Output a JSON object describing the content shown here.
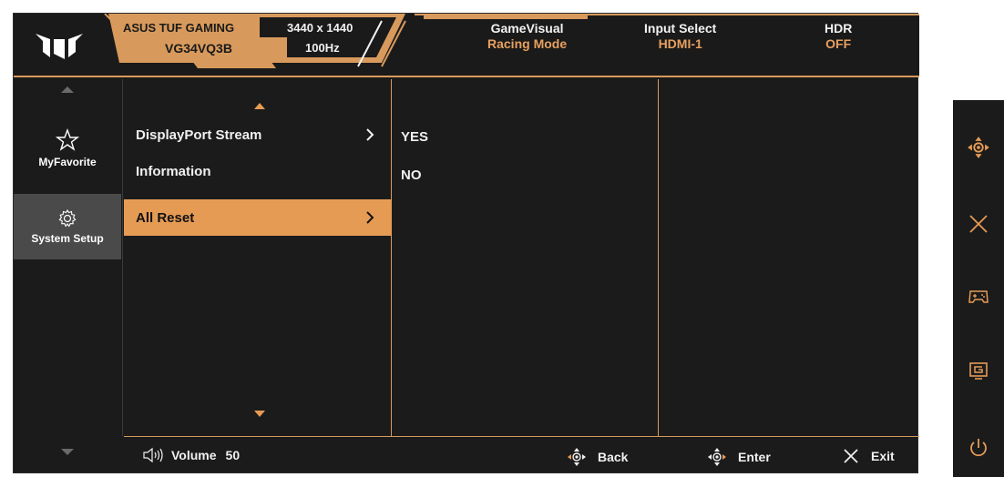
{
  "header": {
    "brand": "ASUS TUF GAMING",
    "model": "VG34VQ3B",
    "resolution": "3440 x 1440",
    "refresh": "100Hz",
    "gamevisual": {
      "label": "GameVisual",
      "value": "Racing Mode"
    },
    "input_select": {
      "label": "Input Select",
      "value": "HDMI-1"
    },
    "hdr": {
      "label": "HDR",
      "value": "OFF"
    }
  },
  "sidebar": {
    "items": [
      {
        "label": "MyFavorite",
        "icon": "star-icon",
        "selected": false
      },
      {
        "label": "System Setup",
        "icon": "gear-icon",
        "selected": true
      }
    ]
  },
  "menu": {
    "items": [
      {
        "label": "DisplayPort Stream",
        "has_submenu": true,
        "selected": false
      },
      {
        "label": "Information",
        "has_submenu": false,
        "selected": false
      },
      {
        "label": "All Reset",
        "has_submenu": true,
        "selected": true
      }
    ]
  },
  "options": [
    "YES",
    "NO"
  ],
  "footer": {
    "volume_label": "Volume",
    "volume_value": "50",
    "back_label": "Back",
    "enter_label": "Enter",
    "exit_label": "Exit"
  },
  "controls": [
    "navigate-joystick-icon",
    "close-icon",
    "gamepad-icon",
    "gameplus-icon",
    "power-icon"
  ],
  "colors": {
    "accent": "#e69b55",
    "background": "#1b1b1b",
    "selected_sidebar": "#4a4a4a"
  }
}
